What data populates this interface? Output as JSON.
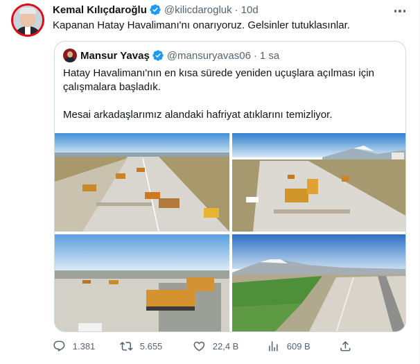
{
  "tweet": {
    "author_name": "Kemal Kılıçdaroğlu",
    "handle": "@kilicdarogluk",
    "separator": "·",
    "time": "10d",
    "text": "Kapanan Hatay Havalimanı'nı onarıyoruz. Gelsinler tutuklasınlar."
  },
  "quote": {
    "author_name": "Mansur Yavaş",
    "handle": "@mansuryavas06",
    "separator": "·",
    "time": "1 sa",
    "paragraph1": "Hatay Havalimanı'nın en kısa sürede yeniden uçuşlara açılması için çalışmalara başladık.",
    "paragraph2": "Mesai arkadaşlarımız alandaki hafriyat atıklarını temizliyor."
  },
  "actions": {
    "replies": "1.381",
    "retweets": "5.655",
    "likes": "22,4 B",
    "views": "609 B"
  },
  "colors": {
    "verified": "#1d9bf0",
    "text_secondary": "#536471",
    "border": "#cfd9de"
  },
  "icons": [
    "verified-badge-icon",
    "more-icon",
    "reply-icon",
    "retweet-icon",
    "like-icon",
    "views-icon",
    "share-icon"
  ]
}
